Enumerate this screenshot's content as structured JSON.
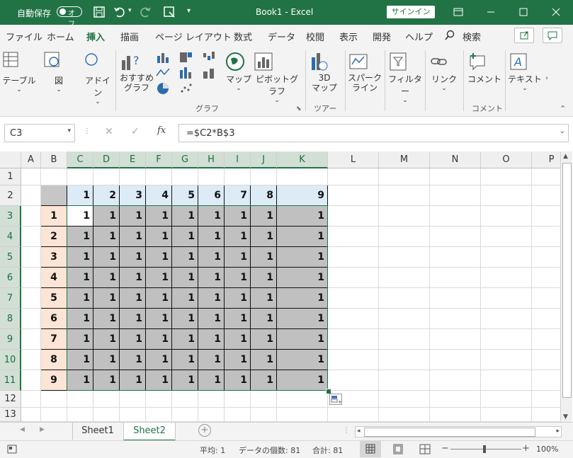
{
  "titlebar": {
    "autosave_label": "自動保存",
    "autosave_state": "オフ",
    "title": "Book1  -  Excel",
    "signin": "サインイン",
    "bg_color": "#217346"
  },
  "tabs": [
    "ファイル",
    "ホーム",
    "挿入",
    "描画",
    "ページ レイアウト",
    "数式",
    "データ",
    "校閲",
    "表示",
    "開発",
    "ヘルプ",
    "検索"
  ],
  "active_tab": "挿入",
  "ribbon": {
    "table": "テーブル",
    "illustrations": "図",
    "addins": "アドイン",
    "recommended_charts": "おすすめ\nグラフ",
    "maps": "マップ",
    "pivot_chart": "ピボットグラフ",
    "map3d": "3D\nマップ",
    "sparklines": "スパーク\nライン",
    "filter": "フィルター",
    "link": "リンク",
    "comment": "コメント",
    "text": "テキスト",
    "group_chart": "グラフ",
    "group_tour": "ツアー",
    "group_comment": "コメント"
  },
  "formula_bar": {
    "name_box": "C3",
    "formula": "=$C2*B$3"
  },
  "columns": [
    "A",
    "B",
    "C",
    "D",
    "E",
    "F",
    "G",
    "H",
    "I",
    "J",
    "K",
    "L",
    "M",
    "N",
    "O",
    "P"
  ],
  "rows": [
    "1",
    "2",
    "3",
    "4",
    "5",
    "6",
    "7",
    "8",
    "9",
    "10",
    "11",
    "12",
    "13"
  ],
  "header_row_values": [
    "1",
    "2",
    "3",
    "4",
    "5",
    "6",
    "7",
    "8",
    "9"
  ],
  "header_col_values": [
    "1",
    "2",
    "3",
    "4",
    "5",
    "6",
    "7",
    "8",
    "9"
  ],
  "body_value": "1",
  "sheets": [
    "Sheet1",
    "Sheet2"
  ],
  "active_sheet": "Sheet2",
  "status": {
    "average": "平均: 1",
    "count": "データの個数: 81",
    "sum": "合計: 81",
    "zoom": "100%"
  }
}
